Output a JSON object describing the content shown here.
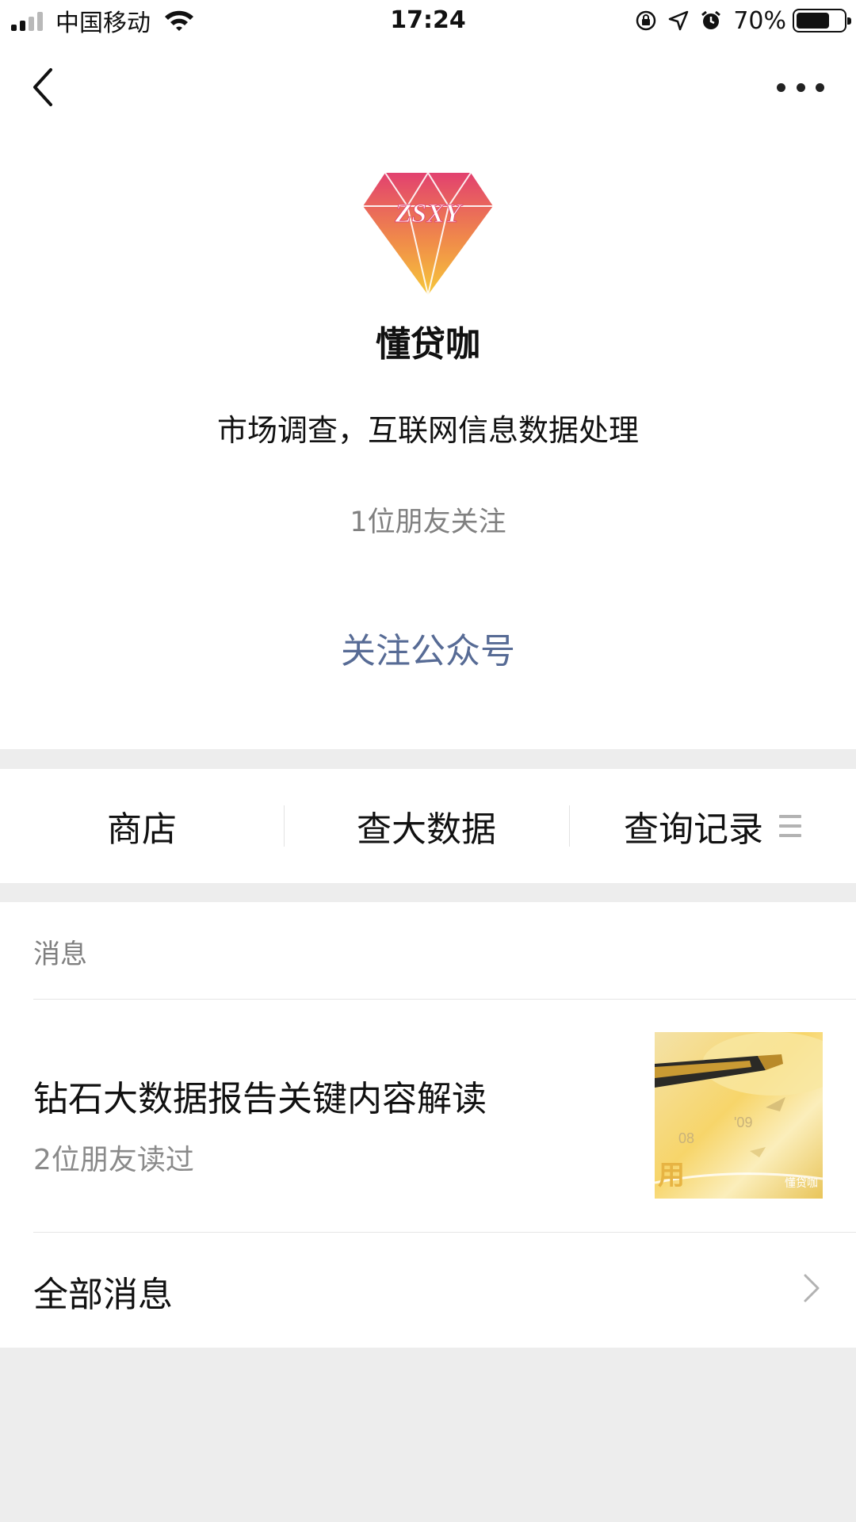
{
  "status_bar": {
    "carrier": "中国移动",
    "time": "17:24",
    "battery_percent": "70%",
    "battery_level": 0.7,
    "icons": [
      "signal-icon",
      "wifi-icon",
      "orientation-lock-icon",
      "location-icon",
      "alarm-icon",
      "battery-icon"
    ]
  },
  "nav": {
    "back_icon": "chevron-left-icon",
    "more_icon": "more-dots-icon"
  },
  "profile": {
    "logo_text": "ZSXY",
    "name": "懂贷咖",
    "description": "市场调查，互联网信息数据处理",
    "friends_following": "1位朋友关注",
    "follow_button": "关注公众号"
  },
  "menu": {
    "items": [
      {
        "label": "商店"
      },
      {
        "label": "查大数据"
      },
      {
        "label": "查询记录"
      }
    ],
    "submenu_icon": "list-icon"
  },
  "messages": {
    "section_label": "消息",
    "article": {
      "title": "钻石大数据报告关键内容解读",
      "reads": "2位朋友读过",
      "thumbnail_label": "用",
      "thumbnail_watermark": "懂贷咖"
    },
    "all_messages_label": "全部消息"
  },
  "colors": {
    "link": "#576b95",
    "background": "#ededed",
    "logo_top": "#e2416f",
    "logo_bottom": "#f6c83a"
  }
}
